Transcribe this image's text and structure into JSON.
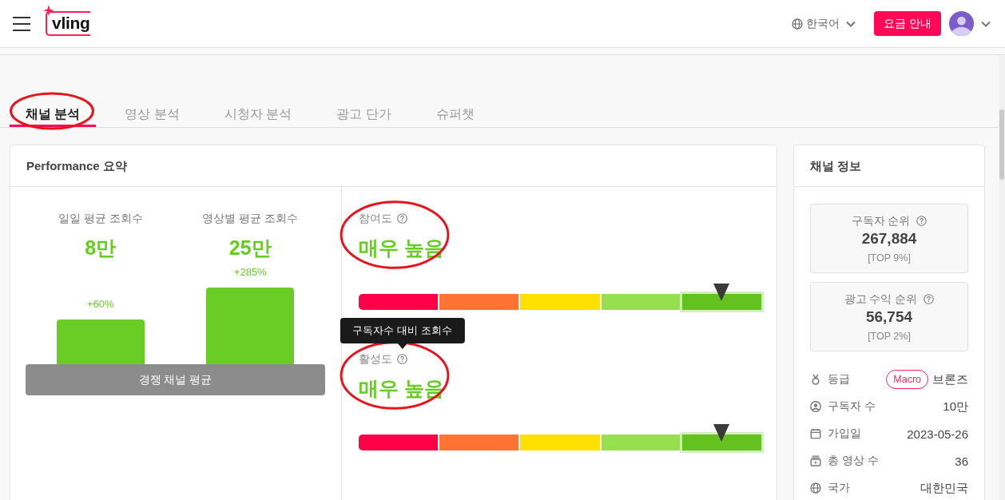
{
  "header": {
    "logo": "vling",
    "language": "한국어",
    "pricing_button": "요금 안내"
  },
  "tabs": [
    {
      "label": "채널 분석",
      "selected": true,
      "circled": true
    },
    {
      "label": "영상 분석",
      "selected": false,
      "circled": false
    },
    {
      "label": "시청자 분석",
      "selected": false,
      "circled": false
    },
    {
      "label": "광고 단가",
      "selected": false,
      "circled": false
    },
    {
      "label": "슈퍼챗",
      "selected": false,
      "circled": false
    }
  ],
  "performance": {
    "title": "Performance 요약",
    "metrics": [
      {
        "label": "일일 평균 조회수",
        "value": "8만",
        "change": "+60%"
      },
      {
        "label": "영상별 평균 조회수",
        "value": "25만",
        "change": "+285%"
      }
    ],
    "baseline": "경쟁 채널 평균",
    "gauges": [
      {
        "label": "참여도",
        "value": "매우 높음",
        "circled": true,
        "segments": [
          {
            "color": "#ff0048",
            "selected": false
          },
          {
            "color": "#ff7433",
            "selected": false
          },
          {
            "color": "#ffe000",
            "selected": false
          },
          {
            "color": "#96e050",
            "selected": false
          },
          {
            "color": "#64c21e",
            "selected": true
          }
        ]
      },
      {
        "label": "활성도",
        "value": "매우 높음",
        "circled": true,
        "tooltip": "구독자수 대비 조회수",
        "segments": [
          {
            "color": "#ff0048",
            "selected": false
          },
          {
            "color": "#ff7433",
            "selected": false
          },
          {
            "color": "#ffe000",
            "selected": false
          },
          {
            "color": "#96e050",
            "selected": false
          },
          {
            "color": "#64c21e",
            "selected": true
          }
        ]
      }
    ]
  },
  "channel_info": {
    "title": "채널 정보",
    "ranks": [
      {
        "label": "구독자 순위",
        "value": "267,884",
        "share": "[TOP 9%]"
      },
      {
        "label": "광고 수익 순위",
        "value": "56,754",
        "share": "[TOP 2%]"
      }
    ],
    "details": [
      {
        "kind": "grade",
        "label": "등급",
        "badge": "Macro",
        "value": "브론즈"
      },
      {
        "kind": "subscribers",
        "label": "구독자 수",
        "value": "10만"
      },
      {
        "kind": "joined",
        "label": "가입일",
        "value": "2023-05-26"
      },
      {
        "kind": "videos",
        "label": "총 영상 수",
        "value": "36"
      },
      {
        "kind": "country",
        "label": "국가",
        "value": "대한민국"
      }
    ]
  }
}
